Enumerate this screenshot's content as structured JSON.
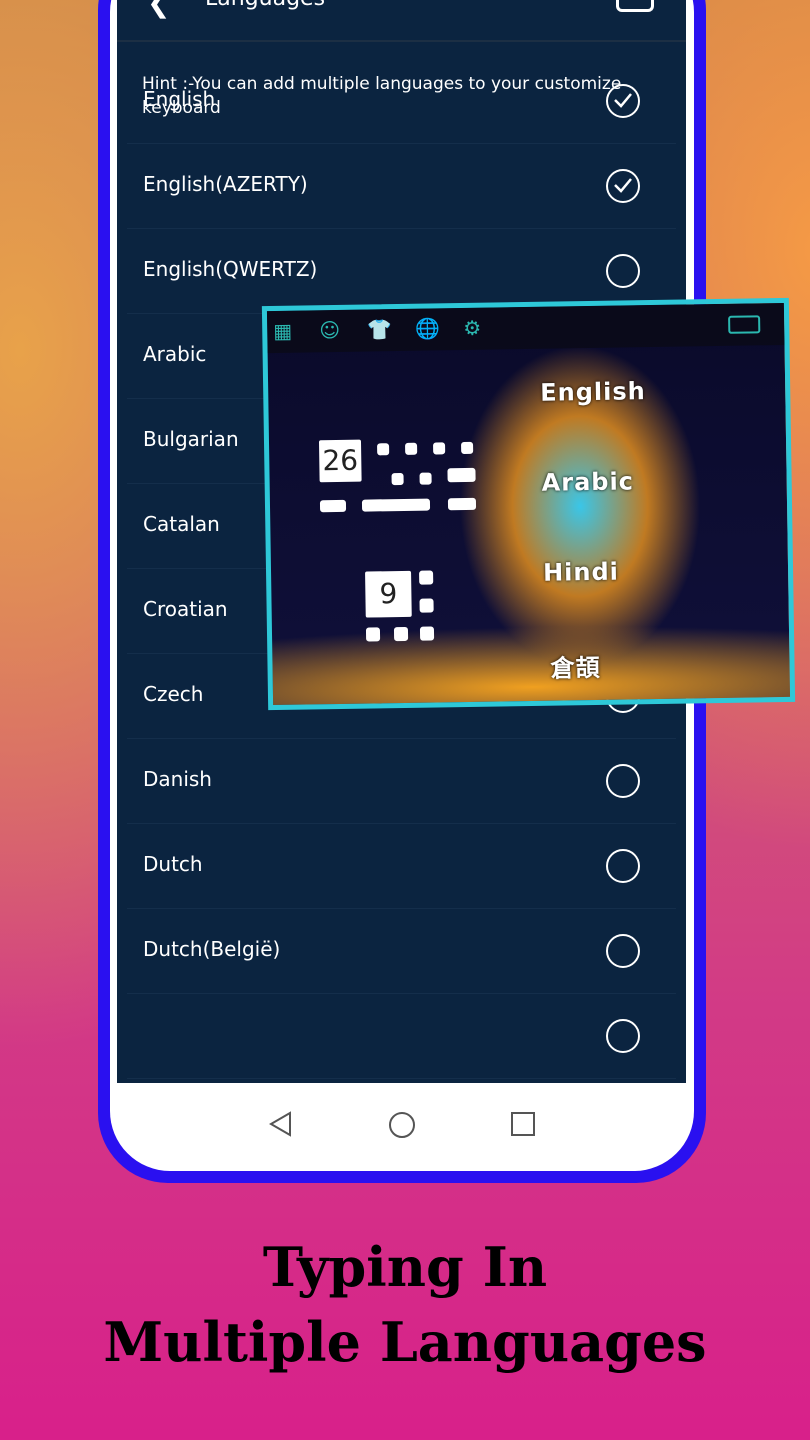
{
  "header": {
    "title": "Languages"
  },
  "hint": "Hint :-You can add multiple languages to your customize keyboard",
  "languages": [
    {
      "label": "English",
      "selected": true
    },
    {
      "label": "English(AZERTY)",
      "selected": true
    },
    {
      "label": "English(QWERTZ)",
      "selected": false
    },
    {
      "label": "Arabic",
      "selected": false
    },
    {
      "label": "Bulgarian",
      "selected": false
    },
    {
      "label": "Catalan",
      "selected": false
    },
    {
      "label": "Croatian",
      "selected": false
    },
    {
      "label": "Czech",
      "selected": false
    },
    {
      "label": "Danish",
      "selected": false
    },
    {
      "label": "Dutch",
      "selected": false
    },
    {
      "label": "Dutch(België)",
      "selected": false
    },
    {
      "label": "",
      "selected": false
    }
  ],
  "keyboard_preview": {
    "toolbar_icons": [
      "apps-icon",
      "emoji-icon",
      "theme-shirt-icon",
      "globe-icon",
      "gear-icon",
      "keyboard-icon"
    ],
    "layout_counts": [
      "26",
      "9"
    ],
    "languages": [
      "English",
      "Arabic",
      "Hindi",
      "倉頡"
    ]
  },
  "promo": {
    "line1": "Typing In",
    "line2": "Multiple Languages"
  },
  "colors": {
    "frame": "#2a10f0",
    "screen": "#0b2440",
    "accent": "#2ec8d8"
  }
}
